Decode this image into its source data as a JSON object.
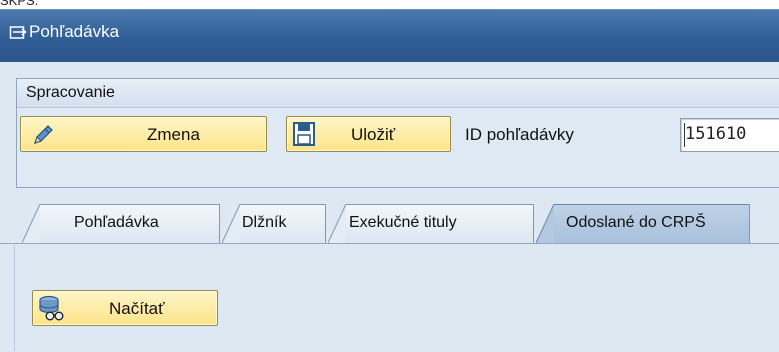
{
  "window": {
    "title": "Pohľadávka",
    "cropped_top_text": "SKPS."
  },
  "processing": {
    "group_title": "Spracovanie",
    "change_button": "Zmena",
    "save_button": "Uložiť",
    "id_label": "ID pohľadávky",
    "id_value": "151610"
  },
  "tabs": [
    {
      "label": "Pohľadávka",
      "active": false
    },
    {
      "label": "Dlžník",
      "active": false
    },
    {
      "label": "Exekučné tituly",
      "active": false
    },
    {
      "label": "Odoslané do CRPŠ",
      "active": true
    }
  ],
  "tab_content": {
    "load_button": "Načítať"
  },
  "colors": {
    "title_bar": "#2f5d95",
    "button_face": "#fde48a",
    "background": "#dde8f2"
  },
  "icons": {
    "window": "display-icon",
    "change": "pencil-icon",
    "save": "floppy-disk-icon",
    "load": "database-binoculars-icon"
  }
}
